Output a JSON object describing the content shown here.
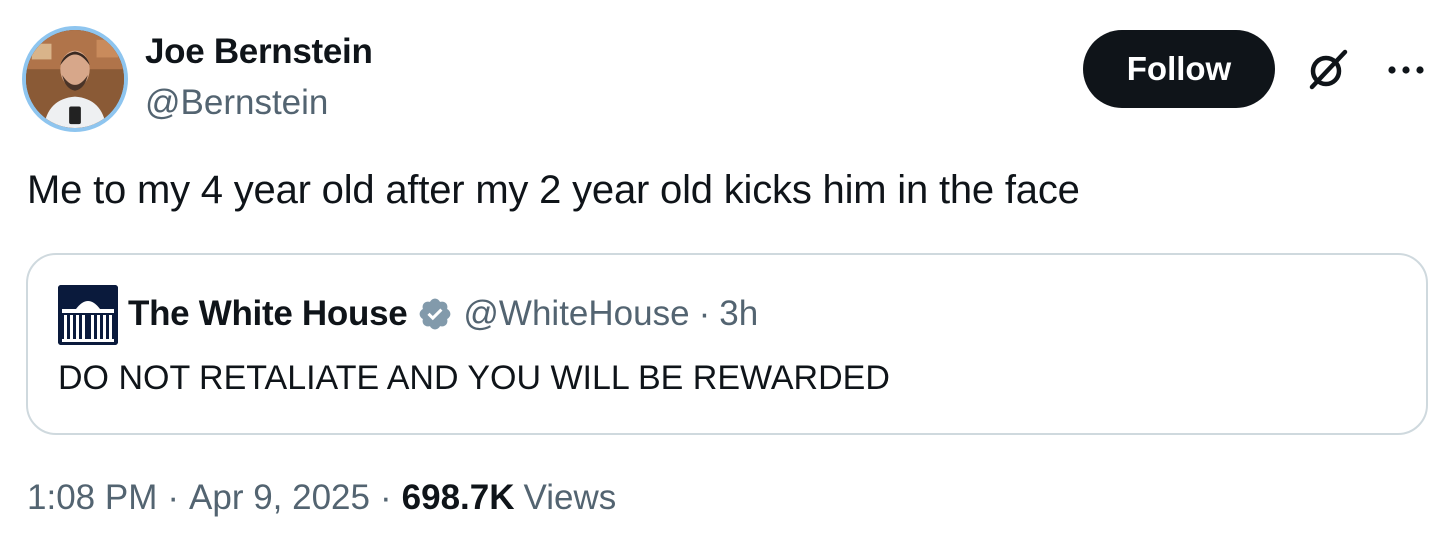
{
  "author": {
    "name": "Joe Bernstein",
    "handle": "@Bernstein"
  },
  "actions": {
    "follow_label": "Follow",
    "grok_icon": "grok-icon",
    "more_icon": "more-icon"
  },
  "tweet": {
    "text": "Me to my 4 year old after my 2 year old kicks him in the face"
  },
  "quote": {
    "name": "The White House",
    "verified_icon": "verified-badge-icon",
    "verified_color": "#829aab",
    "handle": "@WhiteHouse",
    "separator": "·",
    "time": "3h",
    "text": "DO NOT RETALIATE AND YOU WILL BE REWARDED"
  },
  "meta": {
    "time": "1:08 PM",
    "separator": "·",
    "date": "Apr 9, 2025",
    "views_count": "698.7K",
    "views_label": "Views"
  },
  "colors": {
    "text_primary": "#0f1419",
    "text_secondary": "#536471",
    "border": "#cfd9de",
    "follow_bg": "#0f1419",
    "avatar_ring": "#8ec5ef"
  }
}
